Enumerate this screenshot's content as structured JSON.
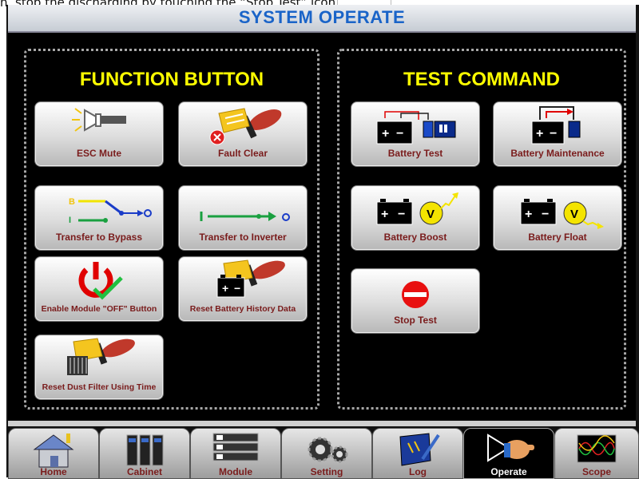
{
  "caption": {
    "prefix": "n, stop the discharging by touching the “Stop Test” icon",
    "suffix": "."
  },
  "header": {
    "title": "SYSTEM OPERATE"
  },
  "function_panel": {
    "title": "FUNCTION BUTTON",
    "buttons": [
      {
        "label": "ESC Mute",
        "icon": "buzzer-icon"
      },
      {
        "label": "Fault Clear",
        "icon": "fault-clear-icon"
      },
      {
        "label": "Transfer to Bypass",
        "icon": "transfer-bypass-icon"
      },
      {
        "label": "Transfer to Inverter",
        "icon": "transfer-inverter-icon"
      },
      {
        "label": "Enable Module \"OFF\" Button",
        "icon": "power-check-icon"
      },
      {
        "label": "Reset Battery History Data",
        "icon": "reset-battery-icon"
      },
      {
        "label": "Reset Dust Filter Using Time",
        "icon": "reset-filter-icon"
      }
    ],
    "bypass_letters": {
      "b": "B",
      "i": "I"
    }
  },
  "test_panel": {
    "title": "TEST COMMAND",
    "buttons": [
      {
        "label": "Battery Test",
        "icon": "battery-test-icon"
      },
      {
        "label": "Battery Maintenance",
        "icon": "battery-maintenance-icon"
      },
      {
        "label": "Battery Boost",
        "icon": "battery-boost-icon"
      },
      {
        "label": "Battery Float",
        "icon": "battery-float-icon"
      },
      {
        "label": "Stop Test",
        "icon": "stop-icon"
      }
    ],
    "volt_symbol": "V",
    "battery_terms": {
      "plus": "+",
      "minus": "−"
    }
  },
  "nav": {
    "items": [
      {
        "label": "Home",
        "icon": "home-icon"
      },
      {
        "label": "Cabinet",
        "icon": "cabinet-icon"
      },
      {
        "label": "Module",
        "icon": "module-icon"
      },
      {
        "label": "Setting",
        "icon": "gear-icon"
      },
      {
        "label": "Log",
        "icon": "log-icon"
      },
      {
        "label": "Operate",
        "icon": "operate-hand-icon"
      },
      {
        "label": "Scope",
        "icon": "scope-icon"
      }
    ],
    "active": "Operate"
  },
  "colors": {
    "title_yellow": "#ffff00",
    "header_blue": "#1a64c8",
    "label_maroon": "#7a1c1c"
  }
}
